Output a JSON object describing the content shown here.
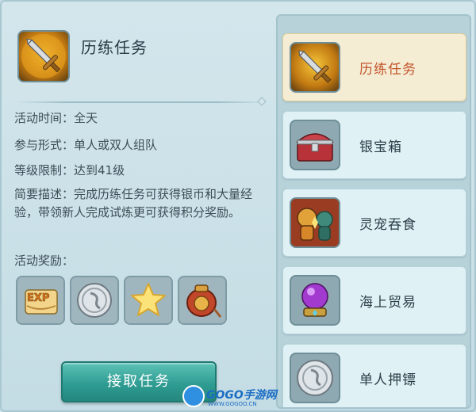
{
  "detail": {
    "title": "历练任务",
    "title_icon": "crossed-swords-icon",
    "info": [
      {
        "label": "活动时间：",
        "value": "全天"
      },
      {
        "label": "参与形式：",
        "value": "单人或双人组队"
      },
      {
        "label": "等级限制：",
        "value": "达到41级"
      }
    ],
    "description_label": "简要描述：",
    "description": "完成历练任务可获得银币和大量经验，带领新人完成试炼更可获得积分奖励。",
    "reward_label": "活动奖励：",
    "rewards": [
      {
        "icon": "exp-scroll-icon"
      },
      {
        "icon": "silver-coin-icon"
      },
      {
        "icon": "star-icon"
      },
      {
        "icon": "reputation-pouch-icon"
      }
    ],
    "accept_button": "接取任务"
  },
  "task_list": [
    {
      "label": "历练任务",
      "icon": "crossed-swords-icon",
      "selected": true
    },
    {
      "label": "银宝箱",
      "icon": "treasure-chest-icon",
      "selected": false
    },
    {
      "label": "灵宠吞食",
      "icon": "spirit-pets-icon",
      "selected": false
    },
    {
      "label": "海上贸易",
      "icon": "crystal-ball-icon",
      "selected": false
    },
    {
      "label": "单人押镖",
      "icon": "silver-coin-icon",
      "selected": false
    }
  ],
  "watermark": {
    "brand": "GOGO手游网",
    "url": "WWW.GOGOO.CN"
  },
  "colors": {
    "selected_label": "#c2542b",
    "accept_button": "#2f9d93",
    "panel_bg": "#d3e6ec"
  }
}
